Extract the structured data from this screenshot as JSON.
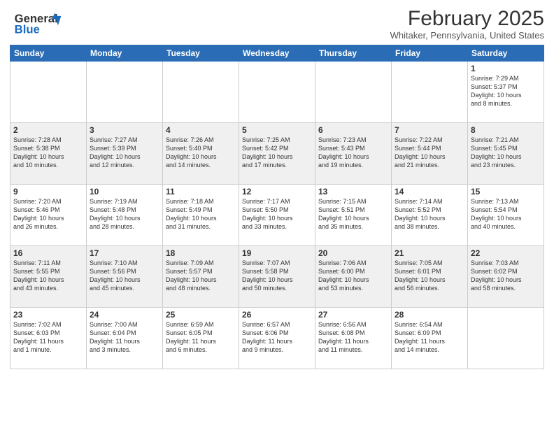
{
  "header": {
    "logo_general": "General",
    "logo_blue": "Blue",
    "month": "February 2025",
    "location": "Whitaker, Pennsylvania, United States"
  },
  "weekdays": [
    "Sunday",
    "Monday",
    "Tuesday",
    "Wednesday",
    "Thursday",
    "Friday",
    "Saturday"
  ],
  "weeks": [
    [
      {
        "day": "",
        "info": ""
      },
      {
        "day": "",
        "info": ""
      },
      {
        "day": "",
        "info": ""
      },
      {
        "day": "",
        "info": ""
      },
      {
        "day": "",
        "info": ""
      },
      {
        "day": "",
        "info": ""
      },
      {
        "day": "1",
        "info": "Sunrise: 7:29 AM\nSunset: 5:37 PM\nDaylight: 10 hours\nand 8 minutes."
      }
    ],
    [
      {
        "day": "2",
        "info": "Sunrise: 7:28 AM\nSunset: 5:38 PM\nDaylight: 10 hours\nand 10 minutes."
      },
      {
        "day": "3",
        "info": "Sunrise: 7:27 AM\nSunset: 5:39 PM\nDaylight: 10 hours\nand 12 minutes."
      },
      {
        "day": "4",
        "info": "Sunrise: 7:26 AM\nSunset: 5:40 PM\nDaylight: 10 hours\nand 14 minutes."
      },
      {
        "day": "5",
        "info": "Sunrise: 7:25 AM\nSunset: 5:42 PM\nDaylight: 10 hours\nand 17 minutes."
      },
      {
        "day": "6",
        "info": "Sunrise: 7:23 AM\nSunset: 5:43 PM\nDaylight: 10 hours\nand 19 minutes."
      },
      {
        "day": "7",
        "info": "Sunrise: 7:22 AM\nSunset: 5:44 PM\nDaylight: 10 hours\nand 21 minutes."
      },
      {
        "day": "8",
        "info": "Sunrise: 7:21 AM\nSunset: 5:45 PM\nDaylight: 10 hours\nand 23 minutes."
      }
    ],
    [
      {
        "day": "9",
        "info": "Sunrise: 7:20 AM\nSunset: 5:46 PM\nDaylight: 10 hours\nand 26 minutes."
      },
      {
        "day": "10",
        "info": "Sunrise: 7:19 AM\nSunset: 5:48 PM\nDaylight: 10 hours\nand 28 minutes."
      },
      {
        "day": "11",
        "info": "Sunrise: 7:18 AM\nSunset: 5:49 PM\nDaylight: 10 hours\nand 31 minutes."
      },
      {
        "day": "12",
        "info": "Sunrise: 7:17 AM\nSunset: 5:50 PM\nDaylight: 10 hours\nand 33 minutes."
      },
      {
        "day": "13",
        "info": "Sunrise: 7:15 AM\nSunset: 5:51 PM\nDaylight: 10 hours\nand 35 minutes."
      },
      {
        "day": "14",
        "info": "Sunrise: 7:14 AM\nSunset: 5:52 PM\nDaylight: 10 hours\nand 38 minutes."
      },
      {
        "day": "15",
        "info": "Sunrise: 7:13 AM\nSunset: 5:54 PM\nDaylight: 10 hours\nand 40 minutes."
      }
    ],
    [
      {
        "day": "16",
        "info": "Sunrise: 7:11 AM\nSunset: 5:55 PM\nDaylight: 10 hours\nand 43 minutes."
      },
      {
        "day": "17",
        "info": "Sunrise: 7:10 AM\nSunset: 5:56 PM\nDaylight: 10 hours\nand 45 minutes."
      },
      {
        "day": "18",
        "info": "Sunrise: 7:09 AM\nSunset: 5:57 PM\nDaylight: 10 hours\nand 48 minutes."
      },
      {
        "day": "19",
        "info": "Sunrise: 7:07 AM\nSunset: 5:58 PM\nDaylight: 10 hours\nand 50 minutes."
      },
      {
        "day": "20",
        "info": "Sunrise: 7:06 AM\nSunset: 6:00 PM\nDaylight: 10 hours\nand 53 minutes."
      },
      {
        "day": "21",
        "info": "Sunrise: 7:05 AM\nSunset: 6:01 PM\nDaylight: 10 hours\nand 56 minutes."
      },
      {
        "day": "22",
        "info": "Sunrise: 7:03 AM\nSunset: 6:02 PM\nDaylight: 10 hours\nand 58 minutes."
      }
    ],
    [
      {
        "day": "23",
        "info": "Sunrise: 7:02 AM\nSunset: 6:03 PM\nDaylight: 11 hours\nand 1 minute."
      },
      {
        "day": "24",
        "info": "Sunrise: 7:00 AM\nSunset: 6:04 PM\nDaylight: 11 hours\nand 3 minutes."
      },
      {
        "day": "25",
        "info": "Sunrise: 6:59 AM\nSunset: 6:05 PM\nDaylight: 11 hours\nand 6 minutes."
      },
      {
        "day": "26",
        "info": "Sunrise: 6:57 AM\nSunset: 6:06 PM\nDaylight: 11 hours\nand 9 minutes."
      },
      {
        "day": "27",
        "info": "Sunrise: 6:56 AM\nSunset: 6:08 PM\nDaylight: 11 hours\nand 11 minutes."
      },
      {
        "day": "28",
        "info": "Sunrise: 6:54 AM\nSunset: 6:09 PM\nDaylight: 11 hours\nand 14 minutes."
      },
      {
        "day": "",
        "info": ""
      }
    ]
  ]
}
